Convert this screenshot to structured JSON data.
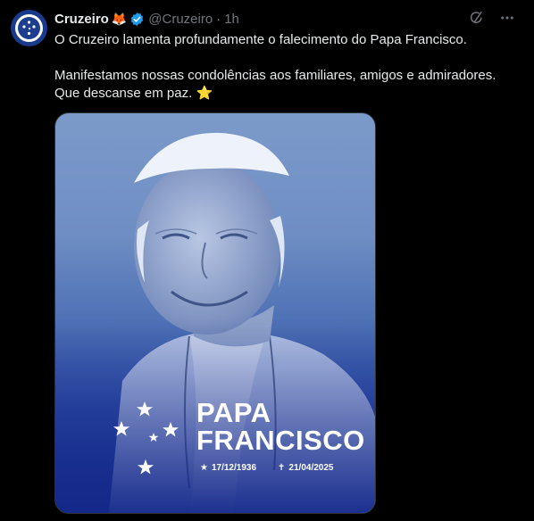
{
  "tweet": {
    "author_name": "Cruzeiro",
    "author_emoji": "🦊",
    "handle": "@Cruzeiro",
    "separator": "·",
    "time": "1h",
    "line1": "O Cruzeiro lamenta profundamente o falecimento do Papa Francisco.",
    "line2": "Manifestamos nossas condolências aos familiares, amigos e admiradores.",
    "line3": "Que descanse em paz.",
    "line3_emoji": "⭐"
  },
  "image": {
    "title_line1": "PAPA",
    "title_line2": "FRANCISCO",
    "birth_symbol": "★",
    "birth_date": "17/12/1936",
    "death_symbol": "✝",
    "death_date": "21/04/2025"
  },
  "colors": {
    "background": "#000000",
    "text": "#e7e9ea",
    "muted": "#71767b",
    "verified": "#1d9bf0",
    "brand_blue": "#1e3d8f"
  },
  "icons": {
    "verified": "verified-badge-icon",
    "grok": "grok-icon",
    "more": "more-icon"
  }
}
